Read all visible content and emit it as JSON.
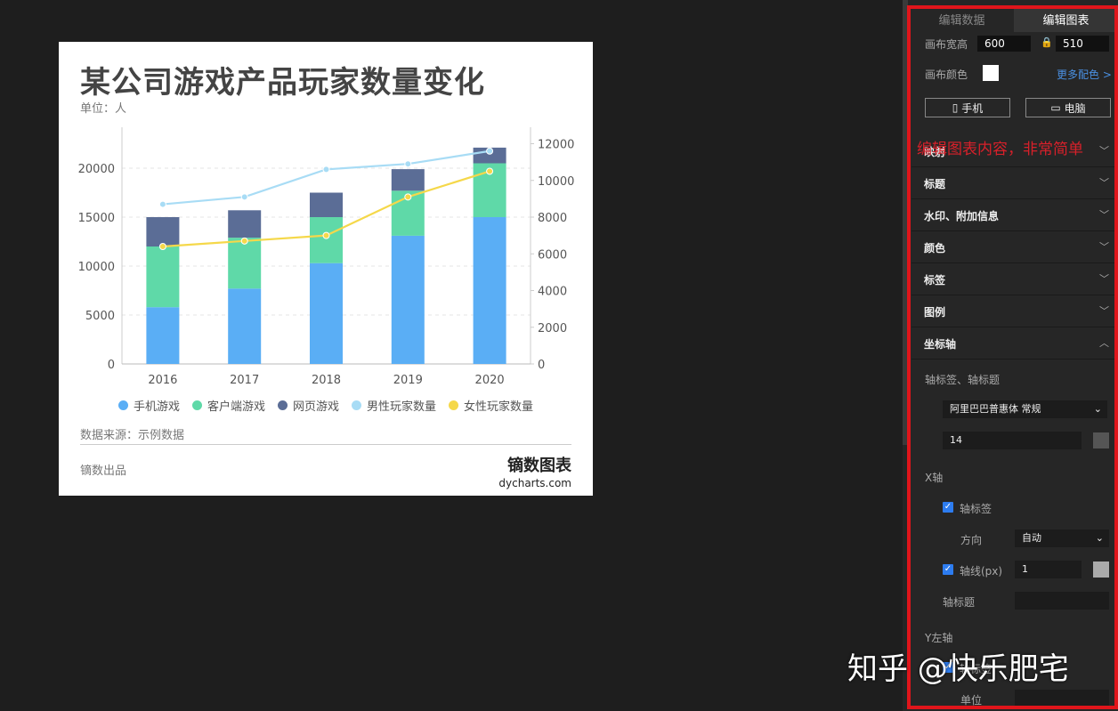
{
  "chart": {
    "title": "某公司游戏产品玩家数量变化",
    "subtitle": "单位：人",
    "source": "数据来源：示例数据",
    "credit": "镝数出品",
    "logo_main": "镝数图表",
    "logo_sub": "dycharts.com"
  },
  "chart_data": {
    "type": "bar",
    "categories": [
      "2016",
      "2017",
      "2018",
      "2019",
      "2020"
    ],
    "left_axis": {
      "ylim": [
        0,
        24000
      ],
      "ticks": [
        "0",
        "5000",
        "10000",
        "15000",
        "20000"
      ]
    },
    "right_axis": {
      "ylim": [
        0,
        12800
      ],
      "ticks": [
        "0",
        "2000",
        "4000",
        "6000",
        "8000",
        "10000",
        "12000"
      ]
    },
    "series": [
      {
        "name": "手机游戏",
        "kind": "stacked-bar",
        "axis": "left",
        "color": "#5aaef5",
        "values": [
          5800,
          7700,
          10300,
          13100,
          15000
        ]
      },
      {
        "name": "客户端游戏",
        "kind": "stacked-bar",
        "axis": "left",
        "color": "#5fd9a8",
        "values": [
          6200,
          5200,
          4700,
          4600,
          5500
        ]
      },
      {
        "name": "网页游戏",
        "kind": "stacked-bar",
        "axis": "left",
        "color": "#5b6d96",
        "values": [
          3000,
          2800,
          2500,
          2200,
          1600
        ]
      },
      {
        "name": "男性玩家数量",
        "kind": "line",
        "axis": "right",
        "color": "#a8dcf5",
        "values": [
          8700,
          9100,
          10600,
          10900,
          11600
        ]
      },
      {
        "name": "女性玩家数量",
        "kind": "line",
        "axis": "right",
        "color": "#f5d84a",
        "values": [
          6400,
          6700,
          7000,
          9100,
          10500
        ]
      }
    ],
    "grid": "dashed horizontal",
    "legend": "bottom"
  },
  "panel": {
    "tabs": [
      {
        "label": "编辑数据",
        "active": false
      },
      {
        "label": "编辑图表",
        "active": true
      }
    ],
    "canvas_size_label": "画布宽高",
    "canvas_width": "600",
    "canvas_height": "510",
    "canvas_color_label": "画布颜色",
    "more_colors": "更多配色 >",
    "mobile_btn": "手机",
    "desktop_btn": "电脑",
    "sections": [
      "映射",
      "标题",
      "水印、附加信息",
      "颜色",
      "标签",
      "图例",
      "坐标轴"
    ],
    "axis_title_label": "轴标签、轴标题",
    "font_select": "阿里巴巴普惠体 常规",
    "font_size": "14",
    "x_axis_label": "X轴",
    "axis_label_check": "轴标签",
    "direction_label": "方向",
    "direction_value": "自动",
    "axis_line_label": "轴线(px)",
    "axis_line_value": "1",
    "axis_title_field_label": "轴标题",
    "y_left_label": "Y左轴",
    "y_axis_label_check": "轴标签",
    "unit_label": "单位"
  },
  "overlay_text": "编辑图表内容，非常简单",
  "watermark": "知乎 @快乐肥宅"
}
